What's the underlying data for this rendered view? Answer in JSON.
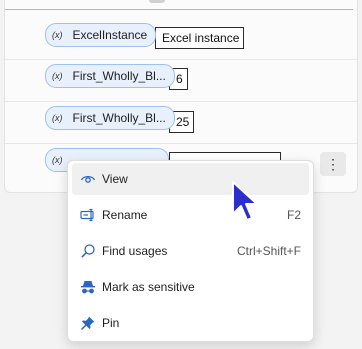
{
  "rows": [
    {
      "chip": "ExcelInstance",
      "value": "Excel instance"
    },
    {
      "chip": "First_Wholly_Bl...",
      "value": "6"
    },
    {
      "chip": "First_Wholly_Bl...",
      "value": "25"
    },
    {
      "chip": "",
      "value": ""
    }
  ],
  "chip_icon": "(x)",
  "more_button_glyph": "⋮",
  "menu": {
    "items": [
      {
        "label": "View",
        "shortcut": "",
        "icon": "eye-icon"
      },
      {
        "label": "Rename",
        "shortcut": "F2",
        "icon": "rename-icon"
      },
      {
        "label": "Find usages",
        "shortcut": "Ctrl+Shift+F",
        "icon": "search-icon"
      },
      {
        "label": "Mark as sensitive",
        "shortcut": "",
        "icon": "incognito-icon"
      },
      {
        "label": "Pin",
        "shortcut": "",
        "icon": "pin-icon"
      }
    ]
  },
  "colors": {
    "accent": "#2a67c4",
    "chip_bg": "#e8f0fc",
    "cursor": "#2c2ec9"
  }
}
